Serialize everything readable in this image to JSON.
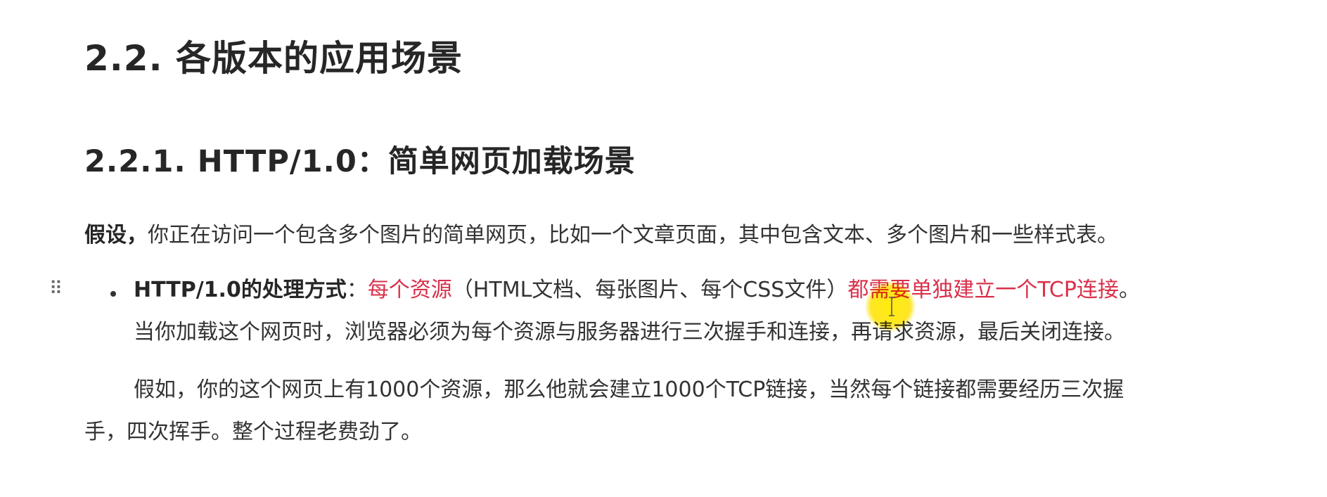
{
  "heading_h2": "2.2. 各版本的应用场景",
  "heading_h3": "2.2.1. HTTP/1.0：简单网页加载场景",
  "para1": {
    "bold": "假设，",
    "text": "你正在访问一个包含多个图片的简单网页，比如一个文章页面，其中包含文本、多个图片和一些样式表。"
  },
  "bullet": {
    "bold": "HTTP/1.0的处理方式",
    "colon": "：",
    "red1": "每个资源",
    "middle": "（HTML文档、每张图片、每个CSS文件）",
    "red2": "都需要单独建立一个TCP连接",
    "end": "。",
    "line2": "当你加载这个网页时，浏览器必须为每个资源与服务器进行三次握手和连接，再请求资源，最后关闭连接。"
  },
  "para3": {
    "line1": "假如，你的这个网页上有1000个资源，那么他就会建立1000个TCP链接，当然每个链接都需要经历三次握",
    "line2": "手，四次挥手。整个过程老费劲了。"
  },
  "icons": {
    "drag_handle": "⠿"
  },
  "colors": {
    "emphasis_red": "#d9304b",
    "cursor_highlight": "#ffe600"
  }
}
